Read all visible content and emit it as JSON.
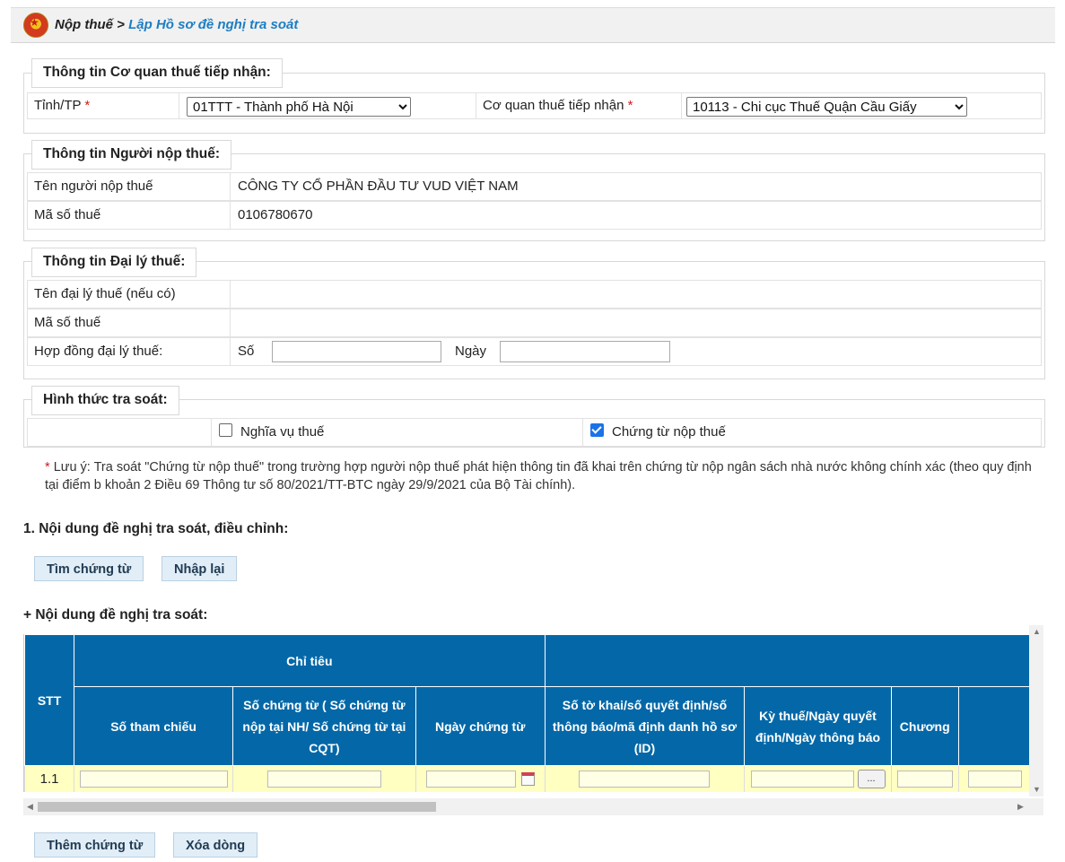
{
  "breadcrumb": {
    "root": "Nộp thuế",
    "sep": " > ",
    "current": "Lập Hồ sơ đề nghị tra soát"
  },
  "agency": {
    "legend": "Thông tin Cơ quan thuế tiếp nhận:",
    "province_label": "Tỉnh/TP",
    "province_value": "01TTT - Thành phố Hà Nội",
    "office_label": "Cơ quan thuế tiếp nhận",
    "office_value": "10113 - Chi cục Thuế Quận Cầu Giấy",
    "required": "*"
  },
  "taxpayer": {
    "legend": "Thông tin Người nộp thuế:",
    "name_label": "Tên người nộp thuế",
    "name_value": "CÔNG TY CỔ PHẦN ĐẦU TƯ VUD VIỆT NAM",
    "tin_label": "Mã số thuế",
    "tin_value": "0106780670"
  },
  "agent": {
    "legend": "Thông tin Đại lý thuế:",
    "name_label": "Tên đại lý thuế (nếu có)",
    "tin_label": "Mã số thuế",
    "contract_label": "Hợp đồng đại lý thuế:",
    "number_label": "Số",
    "date_label": "Ngày"
  },
  "method": {
    "legend": "Hình thức tra soát:",
    "option1": "Nghĩa vụ thuế",
    "option1_checked": false,
    "option2": "Chứng từ nộp thuế",
    "option2_checked": true
  },
  "note": {
    "star": "*",
    "text": "Lưu ý: Tra soát \"Chứng từ nộp thuế\" trong trường hợp người nộp thuế phát hiện thông tin đã khai trên chứng từ nộp ngân sách nhà nước không chính xác (theo quy định tại điểm b khoản 2 Điều 69 Thông tư số 80/2021/TT-BTC ngày 29/9/2021 của Bộ Tài chính)."
  },
  "section1": {
    "title": "1. Nội dung đề nghị tra soát, điều chỉnh:",
    "search_button": "Tìm chứng từ",
    "reset_button": "Nhập lại",
    "subtitle": "+ Nội dung đề nghị tra soát:"
  },
  "grid": {
    "stt": "STT",
    "group": "Chỉ tiêu",
    "columns": [
      "Số tham chiếu",
      "Số chứng từ ( Số chứng từ nộp tại NH/ Số chứng từ tại CQT)",
      "Ngày chứng từ",
      "Số tờ khai/số quyết định/số thông báo/mã định danh hồ sơ (ID)",
      "Kỳ thuế/Ngày quyết định/Ngày thông báo",
      "Chương"
    ],
    "row_index": "1.1",
    "ellipsis": "..."
  },
  "footer": {
    "add_button": "Thêm chứng từ",
    "delete_button": "Xóa dòng"
  },
  "colors": {
    "header_blue": "#0468a8",
    "row_yellow": "#ffffc2",
    "link_blue": "#1d7ec2"
  }
}
